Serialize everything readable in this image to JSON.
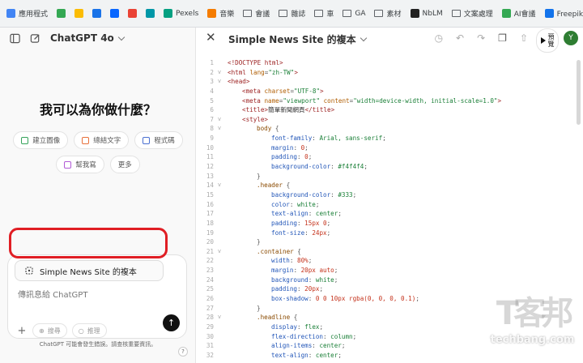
{
  "bookmarks": [
    {
      "label": "應用程式",
      "icon": "apps-grid-icon",
      "color": "#4285f4",
      "kind": "grid"
    },
    {
      "label": "",
      "icon": "green-puzzle-icon",
      "color": "#34a853",
      "kind": "icon"
    },
    {
      "label": "",
      "icon": "grid-app-icon",
      "color": "#fbbc04",
      "kind": "icon"
    },
    {
      "label": "",
      "icon": "circle-c-icon",
      "color": "#1a73e8",
      "kind": "icon"
    },
    {
      "label": "",
      "icon": "meta-icon",
      "color": "#0866ff",
      "kind": "icon"
    },
    {
      "label": "",
      "icon": "trend-icon",
      "color": "#ea4335",
      "kind": "icon"
    },
    {
      "label": "",
      "icon": "s-app-icon",
      "color": "#0097a7",
      "kind": "icon"
    },
    {
      "label": "Pexels",
      "icon": "pexels-icon",
      "color": "#05a081",
      "kind": "icon"
    },
    {
      "label": "音樂",
      "icon": "music-icon",
      "color": "#f57c00",
      "kind": "icon"
    },
    {
      "label": "會議",
      "icon": "folder-icon",
      "color": "#5f6368",
      "kind": "folder"
    },
    {
      "label": "雜誌",
      "icon": "folder-icon",
      "color": "#5f6368",
      "kind": "folder"
    },
    {
      "label": "車",
      "icon": "folder-icon",
      "color": "#5f6368",
      "kind": "folder"
    },
    {
      "label": "GA",
      "icon": "folder-icon",
      "color": "#5f6368",
      "kind": "folder"
    },
    {
      "label": "素材",
      "icon": "folder-icon",
      "color": "#5f6368",
      "kind": "folder"
    },
    {
      "label": "NbLM",
      "icon": "notebooklm-icon",
      "color": "#222222",
      "kind": "icon"
    },
    {
      "label": "文案處理",
      "icon": "folder-icon",
      "color": "#5f6368",
      "kind": "folder"
    },
    {
      "label": "AI會議",
      "icon": "ai-meeting-icon",
      "color": "#34a853",
      "kind": "icon"
    },
    {
      "label": "Freepik | AI圖庫 (...",
      "icon": "freepik-icon",
      "color": "#1273eb",
      "kind": "icon"
    }
  ],
  "left": {
    "model_title": "ChatGPT 4o",
    "hero": "我可以為你做什麼？",
    "suggestions_row1": [
      {
        "label": "建立圖像",
        "color": "#35a35a"
      },
      {
        "label": "總結文字",
        "color": "#e8703a"
      },
      {
        "label": "程式碼",
        "color": "#4a6fd1"
      }
    ],
    "suggestions_row2": [
      {
        "label": "幫我寫",
        "color": "#b15ad6"
      },
      {
        "label": "更多",
        "color": ""
      }
    ],
    "canvas_chip": "Simple News Site 的複本",
    "placeholder": "傳訊息給 ChatGPT",
    "search_label": "搜尋",
    "reason_label": "推理",
    "disclaimer": "ChatGPT 可能會發生錯誤。請查核重要資訊。",
    "help": "?"
  },
  "right": {
    "title": "Simple News Site 的複本",
    "preview_label": "預覽",
    "avatar": "Y"
  },
  "code_lines": [
    {
      "n": 1,
      "f": "",
      "i": 0,
      "t": [
        [
          "tag",
          "<!DOCTYPE html>"
        ]
      ]
    },
    {
      "n": 2,
      "f": "v",
      "i": 0,
      "t": [
        [
          "tag",
          "<html "
        ],
        [
          "attr",
          "lang"
        ],
        [
          "pun",
          "="
        ],
        [
          "str",
          "\"zh-TW\""
        ],
        [
          "tag",
          ">"
        ]
      ]
    },
    {
      "n": 3,
      "f": "v",
      "i": 0,
      "t": [
        [
          "tag",
          "<head>"
        ]
      ]
    },
    {
      "n": 4,
      "f": "",
      "i": 1,
      "t": [
        [
          "tag",
          "<meta "
        ],
        [
          "attr",
          "charset"
        ],
        [
          "pun",
          "="
        ],
        [
          "str",
          "\"UTF-8\""
        ],
        [
          "tag",
          ">"
        ]
      ]
    },
    {
      "n": 5,
      "f": "",
      "i": 1,
      "t": [
        [
          "tag",
          "<meta "
        ],
        [
          "attr",
          "name"
        ],
        [
          "pun",
          "="
        ],
        [
          "str",
          "\"viewport\" "
        ],
        [
          "attr",
          "content"
        ],
        [
          "pun",
          "="
        ],
        [
          "str",
          "\"width=device-width, initial-scale=1.0\""
        ],
        [
          "tag",
          ">"
        ]
      ]
    },
    {
      "n": 6,
      "f": "",
      "i": 1,
      "t": [
        [
          "tag",
          "<title>"
        ],
        [
          "txt",
          "簡單新聞網頁"
        ],
        [
          "tag",
          "</title>"
        ]
      ]
    },
    {
      "n": 7,
      "f": "v",
      "i": 1,
      "t": [
        [
          "tag",
          "<style>"
        ]
      ]
    },
    {
      "n": 8,
      "f": "v",
      "i": 2,
      "t": [
        [
          "sel",
          "body "
        ],
        [
          "pun",
          "{"
        ]
      ]
    },
    {
      "n": 9,
      "f": "",
      "i": 3,
      "t": [
        [
          "prop",
          "font-family"
        ],
        [
          "pun",
          ": "
        ],
        [
          "val",
          "Arial, sans-serif"
        ],
        [
          "pun",
          ";"
        ]
      ]
    },
    {
      "n": 10,
      "f": "",
      "i": 3,
      "t": [
        [
          "prop",
          "margin"
        ],
        [
          "pun",
          ": "
        ],
        [
          "num",
          "0"
        ],
        [
          "pun",
          ";"
        ]
      ]
    },
    {
      "n": 11,
      "f": "",
      "i": 3,
      "t": [
        [
          "prop",
          "padding"
        ],
        [
          "pun",
          ": "
        ],
        [
          "num",
          "0"
        ],
        [
          "pun",
          ";"
        ]
      ]
    },
    {
      "n": 12,
      "f": "",
      "i": 3,
      "t": [
        [
          "prop",
          "background-color"
        ],
        [
          "pun",
          ": "
        ],
        [
          "val",
          "#f4f4f4"
        ],
        [
          "pun",
          ";"
        ]
      ]
    },
    {
      "n": 13,
      "f": "",
      "i": 2,
      "t": [
        [
          "pun",
          "}"
        ]
      ]
    },
    {
      "n": 14,
      "f": "v",
      "i": 2,
      "t": [
        [
          "sel",
          ".header "
        ],
        [
          "pun",
          "{"
        ]
      ]
    },
    {
      "n": 15,
      "f": "",
      "i": 3,
      "t": [
        [
          "prop",
          "background-color"
        ],
        [
          "pun",
          ": "
        ],
        [
          "val",
          "#333"
        ],
        [
          "pun",
          ";"
        ]
      ]
    },
    {
      "n": 16,
      "f": "",
      "i": 3,
      "t": [
        [
          "prop",
          "color"
        ],
        [
          "pun",
          ": "
        ],
        [
          "val",
          "white"
        ],
        [
          "pun",
          ";"
        ]
      ]
    },
    {
      "n": 17,
      "f": "",
      "i": 3,
      "t": [
        [
          "prop",
          "text-align"
        ],
        [
          "pun",
          ": "
        ],
        [
          "val",
          "center"
        ],
        [
          "pun",
          ";"
        ]
      ]
    },
    {
      "n": 18,
      "f": "",
      "i": 3,
      "t": [
        [
          "prop",
          "padding"
        ],
        [
          "pun",
          ": "
        ],
        [
          "num",
          "15px 0"
        ],
        [
          "pun",
          ";"
        ]
      ]
    },
    {
      "n": 19,
      "f": "",
      "i": 3,
      "t": [
        [
          "prop",
          "font-size"
        ],
        [
          "pun",
          ": "
        ],
        [
          "num",
          "24px"
        ],
        [
          "pun",
          ";"
        ]
      ]
    },
    {
      "n": 20,
      "f": "",
      "i": 2,
      "t": [
        [
          "pun",
          "}"
        ]
      ]
    },
    {
      "n": 21,
      "f": "v",
      "i": 2,
      "t": [
        [
          "sel",
          ".container "
        ],
        [
          "pun",
          "{"
        ]
      ]
    },
    {
      "n": 22,
      "f": "",
      "i": 3,
      "t": [
        [
          "prop",
          "width"
        ],
        [
          "pun",
          ": "
        ],
        [
          "num",
          "80%"
        ],
        [
          "pun",
          ";"
        ]
      ]
    },
    {
      "n": 23,
      "f": "",
      "i": 3,
      "t": [
        [
          "prop",
          "margin"
        ],
        [
          "pun",
          ": "
        ],
        [
          "num",
          "20px auto"
        ],
        [
          "pun",
          ";"
        ]
      ]
    },
    {
      "n": 24,
      "f": "",
      "i": 3,
      "t": [
        [
          "prop",
          "background"
        ],
        [
          "pun",
          ": "
        ],
        [
          "val",
          "white"
        ],
        [
          "pun",
          ";"
        ]
      ]
    },
    {
      "n": 25,
      "f": "",
      "i": 3,
      "t": [
        [
          "prop",
          "padding"
        ],
        [
          "pun",
          ": "
        ],
        [
          "num",
          "20px"
        ],
        [
          "pun",
          ";"
        ]
      ]
    },
    {
      "n": 26,
      "f": "",
      "i": 3,
      "t": [
        [
          "prop",
          "box-shadow"
        ],
        [
          "pun",
          ": "
        ],
        [
          "num",
          "0 0 10px rgba(0, 0, 0, 0.1)"
        ],
        [
          "pun",
          ";"
        ]
      ]
    },
    {
      "n": 27,
      "f": "",
      "i": 2,
      "t": [
        [
          "pun",
          "}"
        ]
      ]
    },
    {
      "n": 28,
      "f": "v",
      "i": 2,
      "t": [
        [
          "sel",
          ".headline "
        ],
        [
          "pun",
          "{"
        ]
      ]
    },
    {
      "n": 29,
      "f": "",
      "i": 3,
      "t": [
        [
          "prop",
          "display"
        ],
        [
          "pun",
          ": "
        ],
        [
          "val",
          "flex"
        ],
        [
          "pun",
          ";"
        ]
      ]
    },
    {
      "n": 30,
      "f": "",
      "i": 3,
      "t": [
        [
          "prop",
          "flex-direction"
        ],
        [
          "pun",
          ": "
        ],
        [
          "val",
          "column"
        ],
        [
          "pun",
          ";"
        ]
      ]
    },
    {
      "n": 31,
      "f": "",
      "i": 3,
      "t": [
        [
          "prop",
          "align-items"
        ],
        [
          "pun",
          ": "
        ],
        [
          "val",
          "center"
        ],
        [
          "pun",
          ";"
        ]
      ]
    },
    {
      "n": 32,
      "f": "",
      "i": 3,
      "t": [
        [
          "prop",
          "text-align"
        ],
        [
          "pun",
          ": "
        ],
        [
          "val",
          "center"
        ],
        [
          "pun",
          ";"
        ]
      ]
    }
  ],
  "watermark": {
    "logo": "T客邦",
    "domain": "techbang.com"
  }
}
